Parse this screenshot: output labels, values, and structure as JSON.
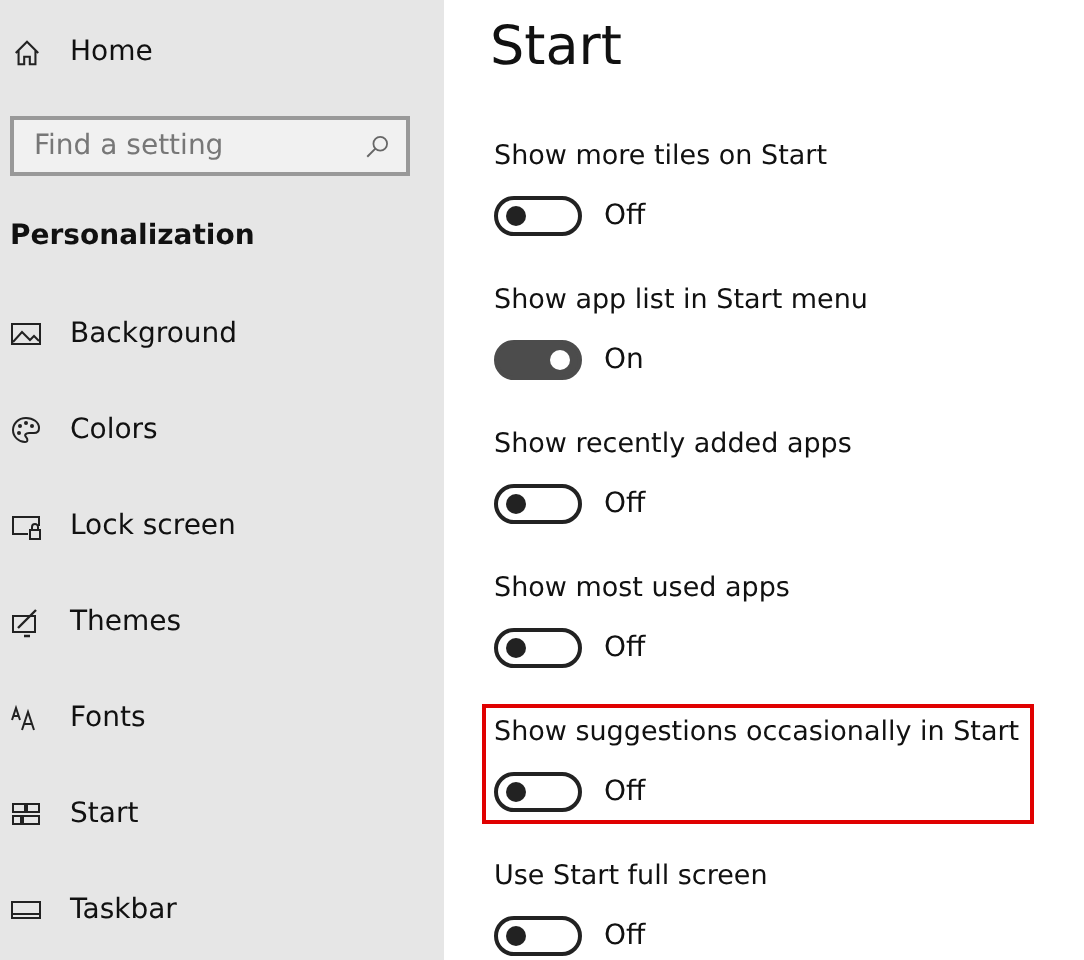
{
  "sidebar": {
    "home": "Home",
    "search": {
      "placeholder": "Find a setting"
    },
    "section": "Personalization",
    "items": [
      {
        "label": "Background"
      },
      {
        "label": "Colors"
      },
      {
        "label": "Lock screen"
      },
      {
        "label": "Themes"
      },
      {
        "label": "Fonts"
      },
      {
        "label": "Start"
      },
      {
        "label": "Taskbar"
      }
    ]
  },
  "page": {
    "title": "Start",
    "settings": [
      {
        "label": "Show more tiles on Start",
        "on": false,
        "state": "Off",
        "highlighted": false
      },
      {
        "label": "Show app list in Start menu",
        "on": true,
        "state": "On",
        "highlighted": false
      },
      {
        "label": "Show recently added apps",
        "on": false,
        "state": "Off",
        "highlighted": false
      },
      {
        "label": "Show most used apps",
        "on": false,
        "state": "Off",
        "highlighted": false
      },
      {
        "label": "Show suggestions occasionally in Start",
        "on": false,
        "state": "Off",
        "highlighted": true
      },
      {
        "label": "Use Start full screen",
        "on": false,
        "state": "Off",
        "highlighted": false
      }
    ]
  }
}
